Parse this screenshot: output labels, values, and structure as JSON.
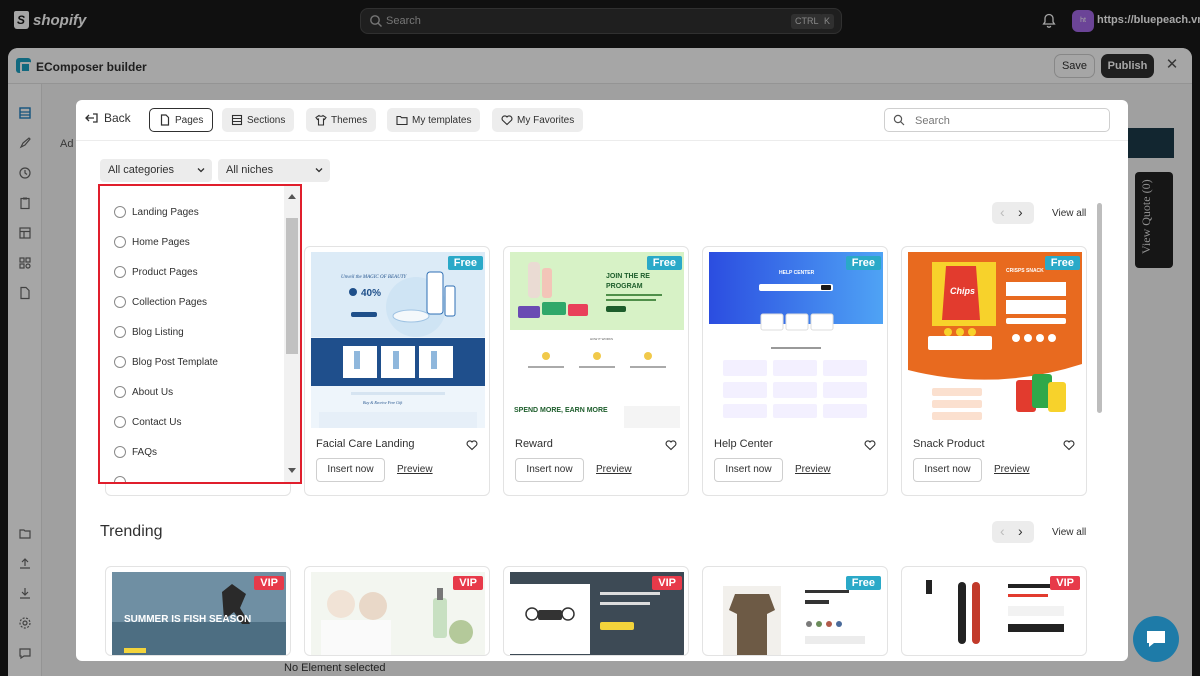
{
  "shopify": {
    "logo_text": "shopify",
    "search_placeholder": "Search",
    "kbd_ctrl": "CTRL",
    "kbd_k": "K",
    "store_initials": "ht",
    "store_url": "https://bluepeach.vn/"
  },
  "app": {
    "title": "EComposer builder",
    "save_label": "Save",
    "publish_label": "Publish",
    "bg_truncated_text": "Ad",
    "view_quote": "View Quote (0)",
    "status_text": "No Element selected"
  },
  "modal": {
    "back_label": "Back",
    "tabs": [
      {
        "label": "Pages",
        "icon": "page-icon",
        "active": true
      },
      {
        "label": "Sections",
        "icon": "sections-icon",
        "active": false
      },
      {
        "label": "Themes",
        "icon": "shirt-icon",
        "active": false
      },
      {
        "label": "My templates",
        "icon": "folder-icon",
        "active": false
      },
      {
        "label": "My Favorites",
        "icon": "heart-icon",
        "active": false
      }
    ],
    "search_placeholder": "Search",
    "filters": {
      "categories": "All categories",
      "niches": "All niches"
    },
    "category_options": [
      "Landing Pages",
      "Home Pages",
      "Product Pages",
      "Collection Pages",
      "Blog Listing",
      "Blog Post Template",
      "About Us",
      "Contact Us",
      "FAQs"
    ],
    "view_all": "View all",
    "insert_label": "Insert now",
    "preview_label": "Preview",
    "section1_cards": [
      {
        "name": "Facial Care Landing",
        "badge": "Free"
      },
      {
        "name": "Reward",
        "badge": "Free"
      },
      {
        "name": "Help Center",
        "badge": "Free"
      },
      {
        "name": "Snack Product",
        "badge": "Free"
      }
    ],
    "trending_title": "Trending",
    "trending_cards": [
      {
        "badge": "VIP",
        "thumb_text": "SUMMER IS FISH SEASON"
      },
      {
        "badge": "VIP"
      },
      {
        "badge": "VIP"
      },
      {
        "badge": "Free"
      },
      {
        "badge": "VIP"
      }
    ],
    "thumb_texts": {
      "facial_headline": "Unveil the MAGIC OF BEAUTY",
      "facial_discount": "40%",
      "reward_headline": "JOIN THE REWARD PROGRAM",
      "reward_sub": "SPEND MORE, EARN MORE",
      "help_headline": "HELP CENTER",
      "snack_headline": "CRISPS SNACK",
      "snack_brand": "Chips"
    }
  },
  "colors": {
    "free_badge": "#2aa9c8",
    "vip_badge": "#e73a4a",
    "highlight_border": "#e01e2c",
    "publish_bg": "#303030"
  }
}
